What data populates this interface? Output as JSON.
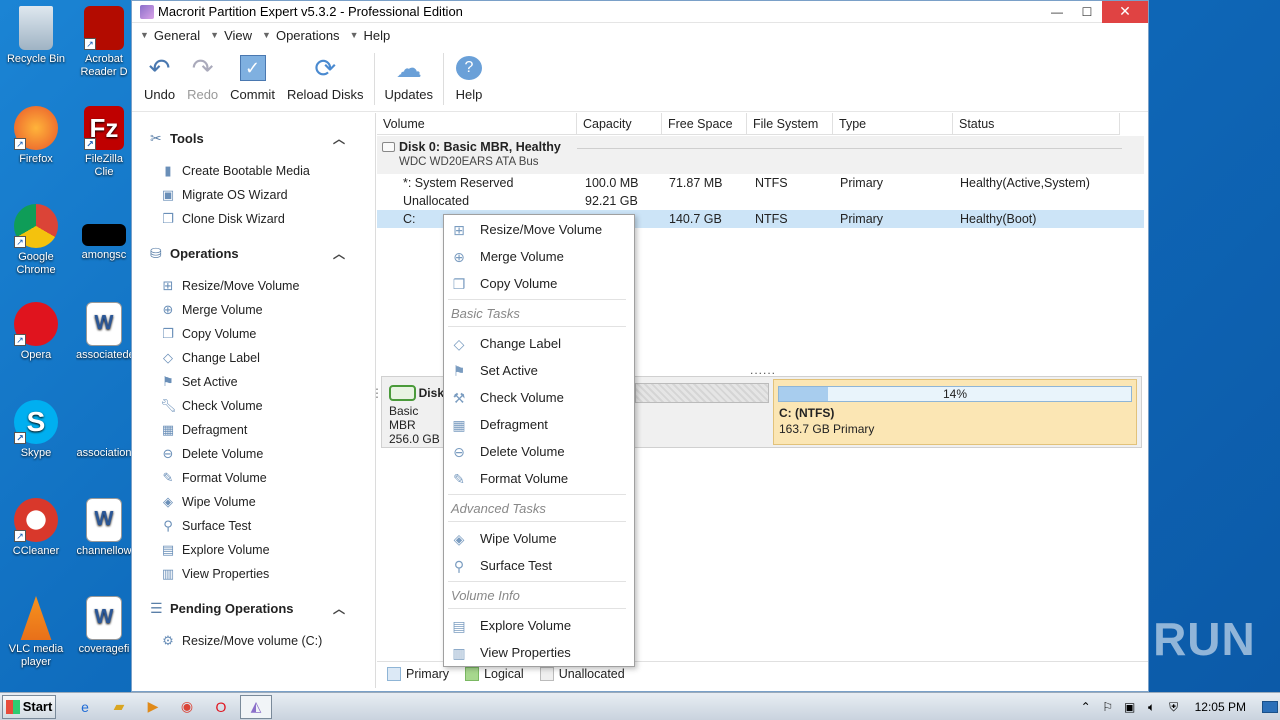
{
  "desktop": {
    "icons_left": [
      {
        "label": "Recycle Bin",
        "icon": "recycle-bin-icon"
      },
      {
        "label": "Firefox",
        "icon": "firefox-icon"
      },
      {
        "label": "Google Chrome",
        "icon": "chrome-icon"
      },
      {
        "label": "Opera",
        "icon": "opera-icon"
      },
      {
        "label": "Skype",
        "icon": "skype-icon"
      },
      {
        "label": "CCleaner",
        "icon": "ccleaner-icon"
      },
      {
        "label": "VLC media player",
        "icon": "vlc-icon"
      }
    ],
    "icons_right": [
      {
        "label": "Acrobat Reader D",
        "icon": "acrobat-icon"
      },
      {
        "label": "FileZilla Clie",
        "icon": "filezilla-icon"
      },
      {
        "label": "amongsc",
        "icon": "black-file-icon"
      },
      {
        "label": "associatede",
        "icon": "word-doc-icon"
      },
      {
        "label": "association",
        "icon": "file-icon"
      },
      {
        "label": "channellow",
        "icon": "word-doc-icon"
      },
      {
        "label": "coveragefi",
        "icon": "word-doc-icon"
      }
    ],
    "watermark": "ANY RUN"
  },
  "window": {
    "title": "Macrorit Partition Expert v5.3.2 - Professional Edition",
    "controls": {
      "minimize": "—",
      "maximize": "☐",
      "close": "✕"
    }
  },
  "menubar": [
    "General",
    "View",
    "Operations",
    "Help"
  ],
  "toolbar": {
    "undo": "Undo",
    "redo": "Redo",
    "commit": "Commit",
    "reload": "Reload Disks",
    "updates": "Updates",
    "help": "Help"
  },
  "left_panel": {
    "tools": {
      "title": "Tools",
      "items": [
        "Create Bootable Media",
        "Migrate OS Wizard",
        "Clone Disk Wizard"
      ]
    },
    "operations": {
      "title": "Operations",
      "items": [
        "Resize/Move Volume",
        "Merge Volume",
        "Copy Volume",
        "Change Label",
        "Set Active",
        "Check Volume",
        "Defragment",
        "Delete Volume",
        "Format Volume",
        "Wipe Volume",
        "Surface Test",
        "Explore Volume",
        "View Properties"
      ]
    },
    "pending": {
      "title": "Pending Operations",
      "items": [
        "Resize/Move volume (C:)"
      ]
    }
  },
  "table": {
    "columns": [
      "Volume",
      "Capacity",
      "Free Space",
      "File System",
      "Type",
      "Status"
    ],
    "disk": {
      "title": "Disk 0: Basic MBR, Healthy",
      "subtitle": "WDC WD20EARS ATA Bus"
    },
    "rows": [
      {
        "volume": "*: System Reserved",
        "capacity": "100.0 MB",
        "free": "71.87 MB",
        "fs": "NTFS",
        "type": "Primary",
        "status": "Healthy(Active,System)"
      },
      {
        "volume": "Unallocated",
        "capacity": "92.21 GB",
        "free": "",
        "fs": "",
        "type": "",
        "status": ""
      },
      {
        "volume": "C:",
        "capacity": "",
        "free": "140.7 GB",
        "fs": "NTFS",
        "type": "Primary",
        "status": "Healthy(Boot)"
      }
    ]
  },
  "splitter": "......",
  "disk_map": {
    "disk_label": "Disk",
    "disk_line2": "Basic MBR",
    "disk_line3": "256.0 GB",
    "c_usage_percent": 14,
    "c_usage_label": "14%",
    "c_name": "C: (NTFS)",
    "c_desc": "163.7 GB Primary"
  },
  "legend": [
    "Primary",
    "Logical",
    "Unallocated"
  ],
  "context_menu": {
    "top_items": [
      "Resize/Move Volume",
      "Merge Volume",
      "Copy Volume"
    ],
    "group_basic": "Basic Tasks",
    "basic_items": [
      "Change Label",
      "Set Active",
      "Check Volume",
      "Defragment",
      "Delete Volume",
      "Format Volume"
    ],
    "group_advanced": "Advanced Tasks",
    "advanced_items": [
      "Wipe Volume",
      "Surface Test"
    ],
    "group_info": "Volume Info",
    "info_items": [
      "Explore Volume",
      "View Properties"
    ]
  },
  "taskbar": {
    "start": "Start",
    "clock": "12:05 PM"
  },
  "colors": {
    "desktop": "#1b84d4",
    "selection": "#cce4f7",
    "c_partition": "#fbe6b4",
    "close_button": "#e04343"
  }
}
